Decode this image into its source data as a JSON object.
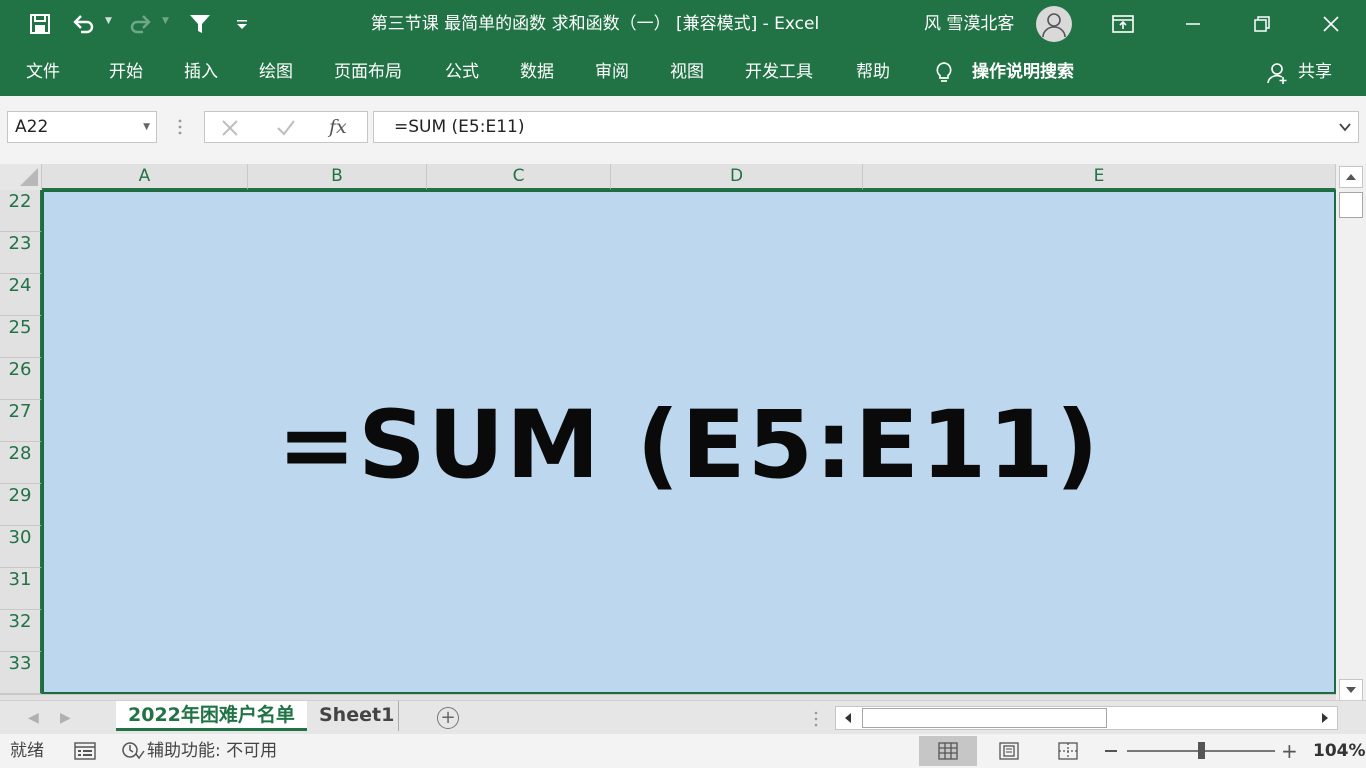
{
  "window": {
    "title": "第三节课  最简单的函数  求和函数（一）  [兼容模式]  -  Excel",
    "user": "风 雪漠北客"
  },
  "ribbon": {
    "tabs": [
      "文件",
      "开始",
      "插入",
      "绘图",
      "页面布局",
      "公式",
      "数据",
      "审阅",
      "视图",
      "开发工具",
      "帮助"
    ],
    "search_label": "操作说明搜索",
    "share_label": "共享"
  },
  "formula_bar": {
    "name_box": "A22",
    "fx_label": "fx",
    "formula": "=SUM (E5:E11)"
  },
  "grid": {
    "columns": [
      "A",
      "B",
      "C",
      "D",
      "E"
    ],
    "rows": [
      "22",
      "23",
      "24",
      "25",
      "26",
      "27",
      "28",
      "29",
      "30",
      "31",
      "32",
      "33"
    ],
    "merged_cell_text": "=SUM (E5:E11)"
  },
  "sheets": {
    "tabs": [
      "2022年困难户名单",
      "Sheet1"
    ],
    "active_index": 0
  },
  "status": {
    "ready": "就绪",
    "accessibility": "辅助功能: 不可用",
    "zoom": "104%",
    "zoom_level": 1.04
  },
  "colors": {
    "excel_green": "#217346",
    "selection_fill": "#bdd7ee"
  }
}
